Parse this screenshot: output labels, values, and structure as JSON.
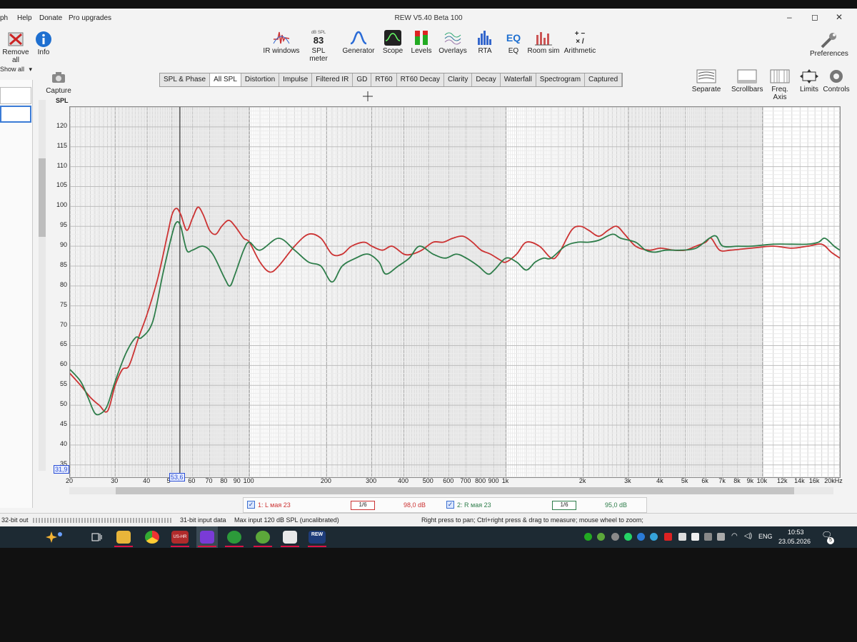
{
  "app": {
    "title": "REW V5.40 Beta 100",
    "window_controls": {
      "minimize": "–",
      "maximize": "◻",
      "close": "✕"
    }
  },
  "menu": {
    "items": [
      "ph",
      "Help",
      "Donate",
      "Pro upgrades"
    ]
  },
  "left_toolbar": {
    "remove_all": "Remove all",
    "info": "Info",
    "show_all": "Show all",
    "capture": "Capture"
  },
  "toolbar": {
    "ir_windows": "IR windows",
    "spl_meter": "SPL meter",
    "spl_meter_small": "dB SPL",
    "spl_meter_value": "83",
    "generator": "Generator",
    "scope": "Scope",
    "levels": "Levels",
    "overlays": "Overlays",
    "rta": "RTA",
    "eq": "EQ",
    "eq_icon_text": "EQ",
    "room_sim": "Room sim",
    "arithmetic": "Arithmetic",
    "arithmetic_icon_text": "+ −\n× /",
    "preferences": "Preferences"
  },
  "tabs": [
    "SPL & Phase",
    "All SPL",
    "Distortion",
    "Impulse",
    "Filtered IR",
    "GD",
    "RT60",
    "RT60 Decay",
    "Clarity",
    "Decay",
    "Waterfall",
    "Spectrogram",
    "Captured"
  ],
  "active_tab": "All SPL",
  "right_toolbar": {
    "separate": "Separate",
    "scrollbars": "Scrollbars",
    "freq_axis": "Freq. Axis",
    "limits": "Limits",
    "controls": "Controls"
  },
  "chart_labels": {
    "y_unit": "SPL",
    "y_min_box": "31,9",
    "cursor_freq_box": "53,6"
  },
  "chart_data": {
    "type": "line",
    "x_scale": "log",
    "xlim": [
      20,
      20000
    ],
    "ylim": [
      31.9,
      125
    ],
    "ylabel": "SPL",
    "x_tick_labels": [
      "20",
      "30",
      "40",
      "5",
      "60",
      "70",
      "80",
      "90",
      "100",
      "200",
      "300",
      "400",
      "500",
      "600",
      "700",
      "800",
      "900",
      "1k",
      "2k",
      "3k",
      "4k",
      "5k",
      "6k",
      "7k",
      "8k",
      "9k",
      "10k",
      "12k",
      "14k",
      "16k",
      "20kHz"
    ],
    "y_tick_labels": [
      "35",
      "40",
      "45",
      "50",
      "55",
      "60",
      "65",
      "70",
      "75",
      "80",
      "85",
      "90",
      "95",
      "100",
      "105",
      "110",
      "115",
      "120"
    ],
    "cursor_frequency": 53.6,
    "grid": true,
    "series": [
      {
        "name": "1: L мая 23",
        "color": "#cc3333",
        "points": [
          [
            20,
            58
          ],
          [
            22,
            55
          ],
          [
            24,
            52
          ],
          [
            26,
            50
          ],
          [
            28,
            48.5
          ],
          [
            30,
            55
          ],
          [
            32,
            59
          ],
          [
            34,
            60
          ],
          [
            37,
            67
          ],
          [
            40,
            73
          ],
          [
            44,
            82
          ],
          [
            48,
            93
          ],
          [
            50,
            98
          ],
          [
            52,
            99.5
          ],
          [
            54,
            98
          ],
          [
            57,
            94
          ],
          [
            60,
            97
          ],
          [
            63,
            99.8
          ],
          [
            66,
            98
          ],
          [
            70,
            94
          ],
          [
            74,
            93
          ],
          [
            78,
            95
          ],
          [
            83,
            96.5
          ],
          [
            88,
            95
          ],
          [
            95,
            92
          ],
          [
            100,
            91
          ],
          [
            110,
            86
          ],
          [
            120,
            83.5
          ],
          [
            130,
            85
          ],
          [
            150,
            90
          ],
          [
            170,
            93
          ],
          [
            190,
            92
          ],
          [
            210,
            88
          ],
          [
            230,
            88
          ],
          [
            250,
            90
          ],
          [
            280,
            91
          ],
          [
            300,
            90
          ],
          [
            330,
            89
          ],
          [
            360,
            90
          ],
          [
            400,
            88
          ],
          [
            430,
            88
          ],
          [
            470,
            89
          ],
          [
            520,
            91
          ],
          [
            570,
            91
          ],
          [
            620,
            92
          ],
          [
            680,
            92.5
          ],
          [
            740,
            91
          ],
          [
            800,
            89
          ],
          [
            870,
            88
          ],
          [
            950,
            86.5
          ],
          [
            1000,
            86
          ],
          [
            1100,
            88
          ],
          [
            1200,
            91
          ],
          [
            1350,
            90
          ],
          [
            1500,
            87
          ],
          [
            1600,
            88
          ],
          [
            1800,
            94
          ],
          [
            1950,
            95
          ],
          [
            2100,
            94
          ],
          [
            2300,
            92.5
          ],
          [
            2500,
            94
          ],
          [
            2700,
            95
          ],
          [
            2900,
            93
          ],
          [
            3200,
            90
          ],
          [
            3600,
            89
          ],
          [
            4000,
            89.5
          ],
          [
            4500,
            89
          ],
          [
            5000,
            89
          ],
          [
            5500,
            90
          ],
          [
            6000,
            91
          ],
          [
            6300,
            92
          ],
          [
            6800,
            89
          ],
          [
            7500,
            89
          ],
          [
            9000,
            89.5
          ],
          [
            11000,
            90
          ],
          [
            13000,
            89.5
          ],
          [
            15000,
            90
          ],
          [
            17000,
            90.5
          ],
          [
            18500,
            88.5
          ],
          [
            20000,
            87
          ]
        ]
      },
      {
        "name": "2: R мая 23",
        "color": "#2e7d4a",
        "points": [
          [
            20,
            59
          ],
          [
            22,
            56
          ],
          [
            23.5,
            52
          ],
          [
            25,
            48
          ],
          [
            26.5,
            48
          ],
          [
            28,
            50
          ],
          [
            30,
            56
          ],
          [
            33,
            63
          ],
          [
            36,
            67
          ],
          [
            38,
            67
          ],
          [
            42,
            71
          ],
          [
            46,
            83
          ],
          [
            50,
            93
          ],
          [
            52,
            96
          ],
          [
            54,
            95
          ],
          [
            57,
            89
          ],
          [
            60,
            89
          ],
          [
            66,
            90
          ],
          [
            72,
            88
          ],
          [
            80,
            82
          ],
          [
            84,
            80
          ],
          [
            88,
            83
          ],
          [
            95,
            89
          ],
          [
            100,
            91
          ],
          [
            110,
            89
          ],
          [
            130,
            92
          ],
          [
            150,
            89
          ],
          [
            170,
            86
          ],
          [
            190,
            85
          ],
          [
            210,
            81
          ],
          [
            230,
            85
          ],
          [
            260,
            87
          ],
          [
            290,
            88
          ],
          [
            320,
            86
          ],
          [
            340,
            83
          ],
          [
            380,
            85
          ],
          [
            420,
            87
          ],
          [
            460,
            90
          ],
          [
            520,
            88
          ],
          [
            580,
            87
          ],
          [
            640,
            88
          ],
          [
            700,
            87
          ],
          [
            780,
            85
          ],
          [
            850,
            83
          ],
          [
            900,
            84
          ],
          [
            1000,
            87
          ],
          [
            1100,
            86
          ],
          [
            1200,
            84
          ],
          [
            1300,
            86
          ],
          [
            1400,
            87
          ],
          [
            1500,
            87
          ],
          [
            1700,
            90
          ],
          [
            1900,
            91
          ],
          [
            2100,
            91
          ],
          [
            2300,
            91.5
          ],
          [
            2600,
            93
          ],
          [
            2800,
            92
          ],
          [
            3200,
            91
          ],
          [
            3500,
            89
          ],
          [
            3800,
            88.5
          ],
          [
            4200,
            89
          ],
          [
            4800,
            89
          ],
          [
            5500,
            89.5
          ],
          [
            6200,
            92
          ],
          [
            6600,
            92.5
          ],
          [
            7000,
            90
          ],
          [
            8000,
            90
          ],
          [
            9000,
            90
          ],
          [
            11000,
            90.5
          ],
          [
            13000,
            90.5
          ],
          [
            15000,
            90.5
          ],
          [
            16500,
            91
          ],
          [
            17500,
            92
          ],
          [
            19000,
            90
          ],
          [
            20000,
            89
          ]
        ]
      }
    ]
  },
  "legend": {
    "items": [
      {
        "label": "1: L мая 23",
        "value": "98,0 dB",
        "color": "#cc3333",
        "smoothing": "1/6"
      },
      {
        "label": "2: R мая 23",
        "value": "95,0 dB",
        "color": "#2e7d4a",
        "smoothing": "1/6"
      }
    ]
  },
  "status": {
    "output": "32-bit out",
    "input": "31-bit input data",
    "max_input": "Max input 120 dB SPL (uncalibrated)",
    "hint": "Right press to pan; Ctrl+right press & drag to measure; mouse wheel to zoom;"
  },
  "taskbar": {
    "language": "ENG",
    "time": "10:53",
    "date": "23.05.2026",
    "notification_count": "5",
    "rew_label": "REW",
    "app_label": "US-HR"
  }
}
